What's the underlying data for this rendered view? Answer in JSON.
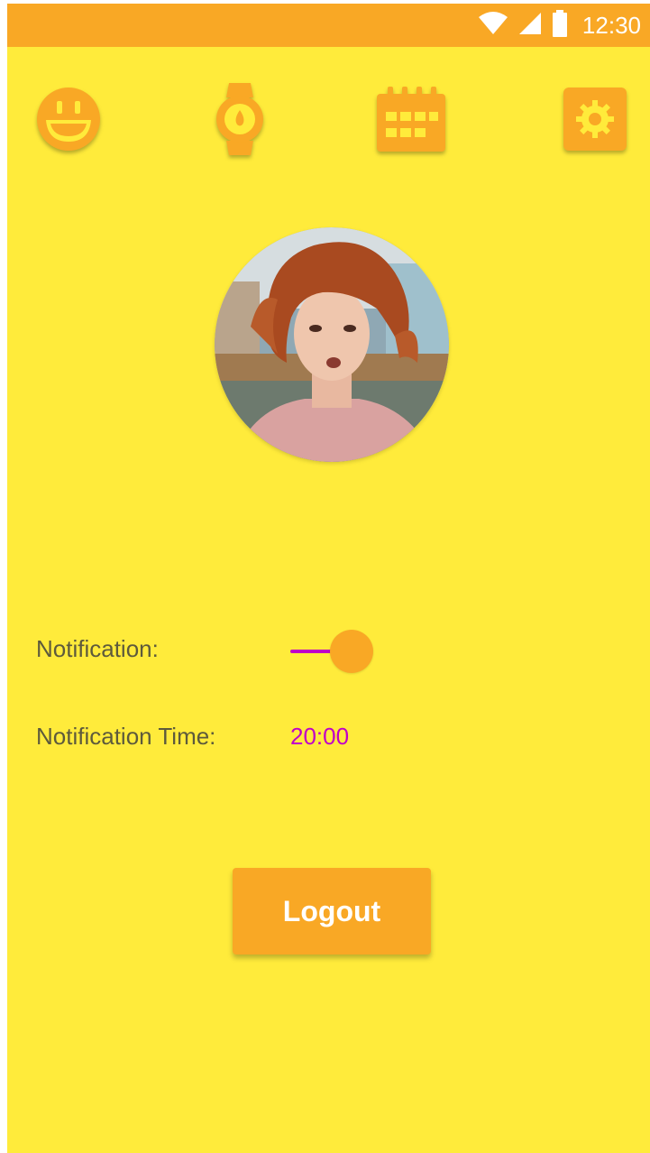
{
  "status_bar": {
    "time": "12:30",
    "icons": [
      "wifi-icon",
      "cell-signal-icon",
      "battery-icon"
    ]
  },
  "nav": {
    "items": [
      {
        "name": "mood",
        "icon": "smiley-face-icon"
      },
      {
        "name": "watch",
        "icon": "watch-icon"
      },
      {
        "name": "calendar",
        "icon": "calendar-icon"
      },
      {
        "name": "settings",
        "icon": "gear-icon"
      }
    ]
  },
  "profile": {
    "avatar": "avatar"
  },
  "settings": {
    "notification_label": "Notification:",
    "notification_enabled": true,
    "notification_time_label": "Notification Time:",
    "notification_time_value": "20:00"
  },
  "actions": {
    "logout_label": "Logout"
  },
  "colors": {
    "background": "#ffeb3b",
    "accent": "#f9a825",
    "switch_track": "#c000c8",
    "time_text": "#c000c8",
    "label_text": "#5d5a3c"
  }
}
